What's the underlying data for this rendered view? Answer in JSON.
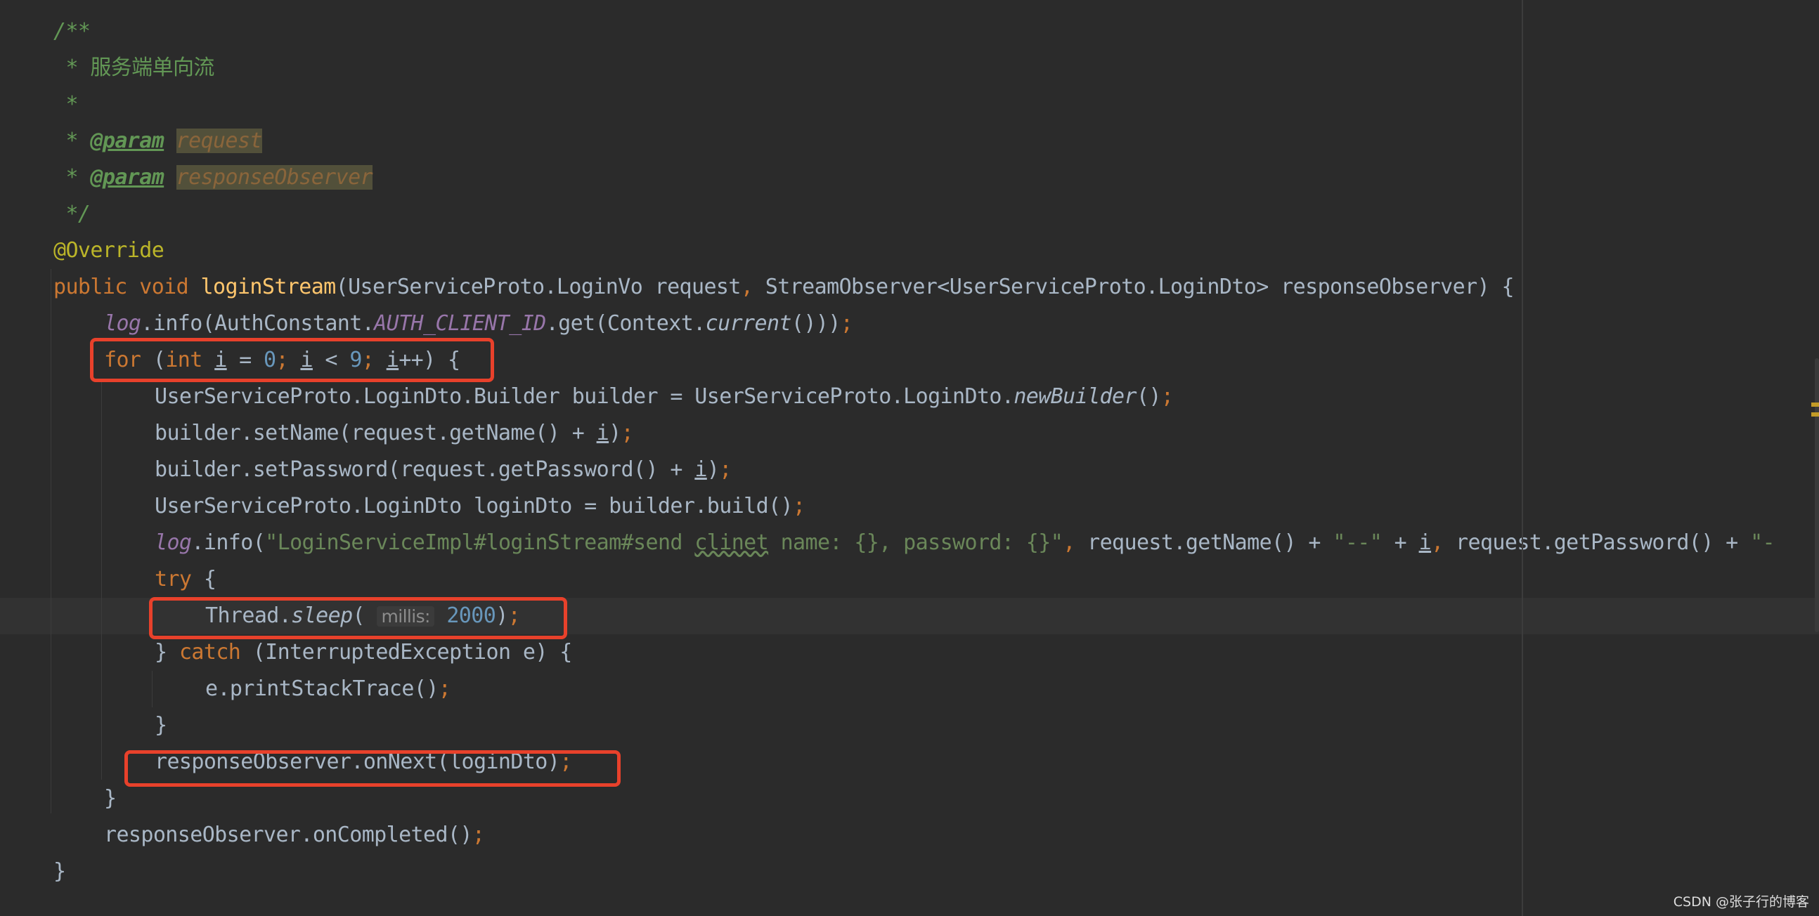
{
  "colors": {
    "background": "#2b2b2b",
    "keyword": "#cc7832",
    "comment": "#629755",
    "annotation": "#bbb529",
    "method": "#ffc66d",
    "number": "#6897bb",
    "string": "#6a8759",
    "field": "#9876aa",
    "text": "#a9b7c6",
    "highlight_box": "#e8412b"
  },
  "editor": {
    "current_line": 16,
    "lines": [
      {
        "indent": 0,
        "tokens": [
          [
            "/**",
            "cm"
          ]
        ]
      },
      {
        "indent": 0,
        "tokens": [
          [
            " * 服务端单向流",
            "cmz"
          ]
        ]
      },
      {
        "indent": 0,
        "tokens": [
          [
            " *",
            "cm"
          ]
        ]
      },
      {
        "indent": 0,
        "tokens": [
          [
            " * ",
            "cm"
          ],
          [
            "@param",
            "tag"
          ],
          [
            " ",
            "cm"
          ],
          [
            "request",
            "pv"
          ]
        ]
      },
      {
        "indent": 0,
        "tokens": [
          [
            " * ",
            "cm"
          ],
          [
            "@param",
            "tag"
          ],
          [
            " ",
            "cm"
          ],
          [
            "responseObserver",
            "pv"
          ]
        ]
      },
      {
        "indent": 0,
        "tokens": [
          [
            " */",
            "cm"
          ]
        ]
      },
      {
        "indent": 0,
        "tokens": [
          [
            "@Override",
            "ann"
          ]
        ]
      },
      {
        "indent": 0,
        "tokens": [
          [
            "public void ",
            "kw"
          ],
          [
            "loginStream",
            "fn"
          ],
          [
            "(UserServiceProto.LoginVo request",
            ""
          ],
          [
            ", ",
            "kw"
          ],
          [
            "StreamObserver<UserServiceProto.LoginDto> responseObserver) {",
            ""
          ]
        ]
      },
      {
        "indent": 1,
        "tokens": [
          [
            "log",
            "fld"
          ],
          [
            ".info(AuthConstant.",
            ""
          ],
          [
            "AUTH_CLIENT_ID",
            "fld"
          ],
          [
            ".get(Context.",
            ""
          ],
          [
            "current",
            "it"
          ],
          [
            "()))",
            ""
          ],
          [
            ";",
            "semi"
          ]
        ]
      },
      {
        "indent": 1,
        "tokens": [
          [
            "for ",
            "kw"
          ],
          [
            "(",
            ""
          ],
          [
            "int ",
            "kw"
          ],
          [
            "i",
            "ul"
          ],
          [
            " = ",
            ""
          ],
          [
            "0",
            "num"
          ],
          [
            "; ",
            "semi"
          ],
          [
            "i",
            "ul"
          ],
          [
            " < ",
            ""
          ],
          [
            "9",
            "num"
          ],
          [
            "; ",
            "semi"
          ],
          [
            "i",
            "ul"
          ],
          [
            "++) {",
            ""
          ]
        ]
      },
      {
        "indent": 2,
        "tokens": [
          [
            "UserServiceProto.LoginDto.Builder builder = UserServiceProto.LoginDto.",
            ""
          ],
          [
            "newBuilder",
            "it"
          ],
          [
            "()",
            ""
          ],
          [
            ";",
            "semi"
          ]
        ]
      },
      {
        "indent": 2,
        "tokens": [
          [
            "builder.setName(request.getName() + ",
            ""
          ],
          [
            "i",
            "ul"
          ],
          [
            ")",
            ""
          ],
          [
            ";",
            "semi"
          ]
        ]
      },
      {
        "indent": 2,
        "tokens": [
          [
            "builder.setPassword(request.getPassword() + ",
            ""
          ],
          [
            "i",
            "ul"
          ],
          [
            ")",
            ""
          ],
          [
            ";",
            "semi"
          ]
        ]
      },
      {
        "indent": 2,
        "tokens": [
          [
            "UserServiceProto.LoginDto loginDto = builder.build()",
            ""
          ],
          [
            ";",
            "semi"
          ]
        ]
      },
      {
        "indent": 2,
        "tokens": [
          [
            "log",
            "fld"
          ],
          [
            ".info(",
            ""
          ],
          [
            "\"LoginServiceImpl#loginStream#send ",
            "str"
          ],
          [
            "clinet",
            "str typo"
          ],
          [
            " name: {}, password: {}\"",
            "str"
          ],
          [
            ", ",
            "kw"
          ],
          [
            "request.getName() + ",
            ""
          ],
          [
            "\"--\"",
            "str"
          ],
          [
            " + ",
            ""
          ],
          [
            "i",
            "ul"
          ],
          [
            ", ",
            "kw"
          ],
          [
            "request.getPassword() + ",
            ""
          ],
          [
            "\"-",
            "str"
          ]
        ]
      },
      {
        "indent": 2,
        "tokens": [
          [
            "try ",
            "kw"
          ],
          [
            "{",
            ""
          ]
        ]
      },
      {
        "indent": 3,
        "tokens": [
          [
            "Thread.",
            ""
          ],
          [
            "sleep",
            "it"
          ],
          [
            "( ",
            ""
          ],
          [
            "millis:",
            "hint"
          ],
          [
            " ",
            ""
          ],
          [
            "2000",
            "num"
          ],
          [
            ")",
            ""
          ],
          [
            ";",
            "semi"
          ]
        ]
      },
      {
        "indent": 2,
        "tokens": [
          [
            "} ",
            ""
          ],
          [
            "catch ",
            "kw"
          ],
          [
            "(InterruptedException e) {",
            ""
          ]
        ]
      },
      {
        "indent": 3,
        "tokens": [
          [
            "e.printStackTrace()",
            ""
          ],
          [
            ";",
            "semi"
          ]
        ]
      },
      {
        "indent": 2,
        "tokens": [
          [
            "}",
            ""
          ]
        ]
      },
      {
        "indent": 2,
        "tokens": [
          [
            "responseObserver.onNext(loginDto)",
            ""
          ],
          [
            ";",
            "semi"
          ]
        ]
      },
      {
        "indent": 1,
        "tokens": [
          [
            "}",
            ""
          ]
        ]
      },
      {
        "indent": 1,
        "tokens": [
          [
            "responseObserver.onCompleted()",
            ""
          ],
          [
            ";",
            "semi"
          ]
        ]
      },
      {
        "indent": 0,
        "tokens": [
          [
            "}",
            ""
          ]
        ]
      }
    ]
  },
  "watermark": "CSDN @张子行的博客"
}
